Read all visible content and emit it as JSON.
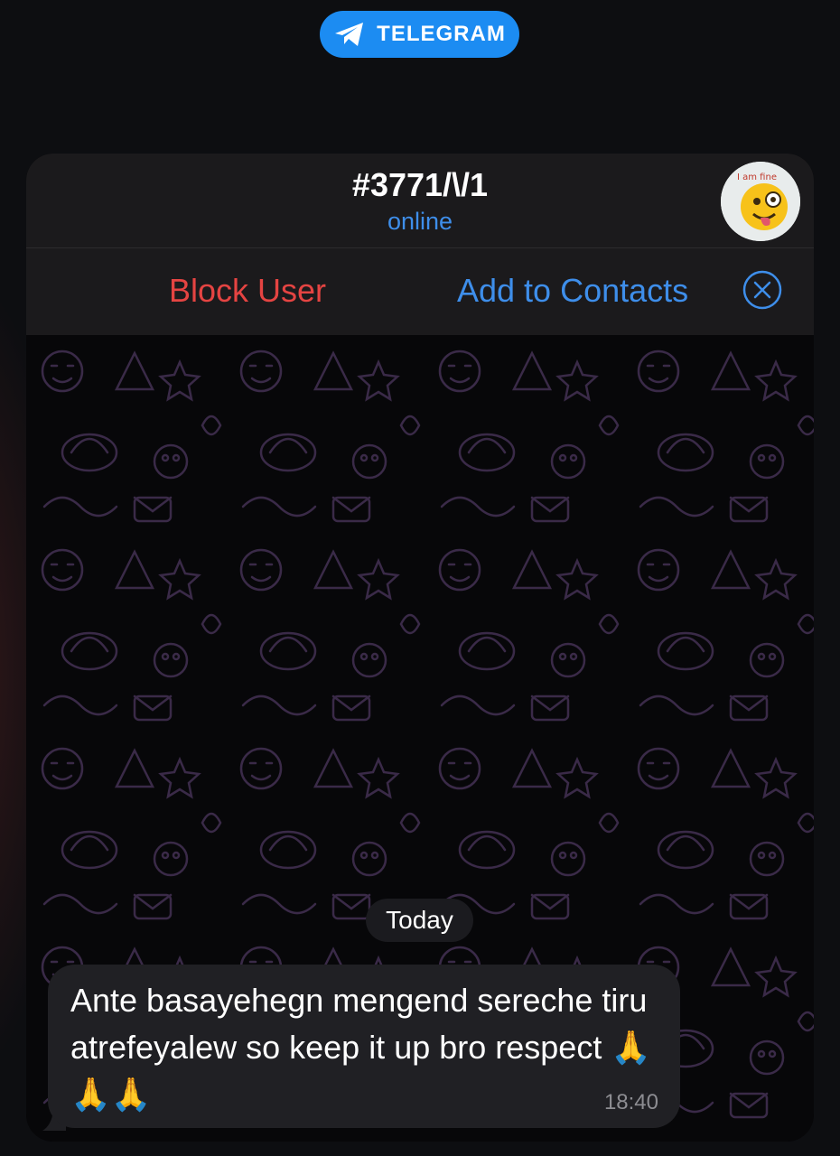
{
  "app": {
    "badge_label": "TELEGRAM",
    "badge_icon": "paper-plane-icon",
    "accent": "#1c8cf2"
  },
  "chat": {
    "title": "#3771/\\/1",
    "status": "online",
    "avatar_text": "I am fine"
  },
  "actions": {
    "block_label": "Block User",
    "add_label": "Add to Contacts",
    "block_color": "#e54442",
    "link_color": "#3e8eea"
  },
  "messages": {
    "date_label": "Today",
    "items": [
      {
        "text": "Ante basayehegn mengend sereche tiru atrefeyalew so keep it up bro respect 🙏🙏🙏",
        "time": "18:40"
      }
    ]
  }
}
